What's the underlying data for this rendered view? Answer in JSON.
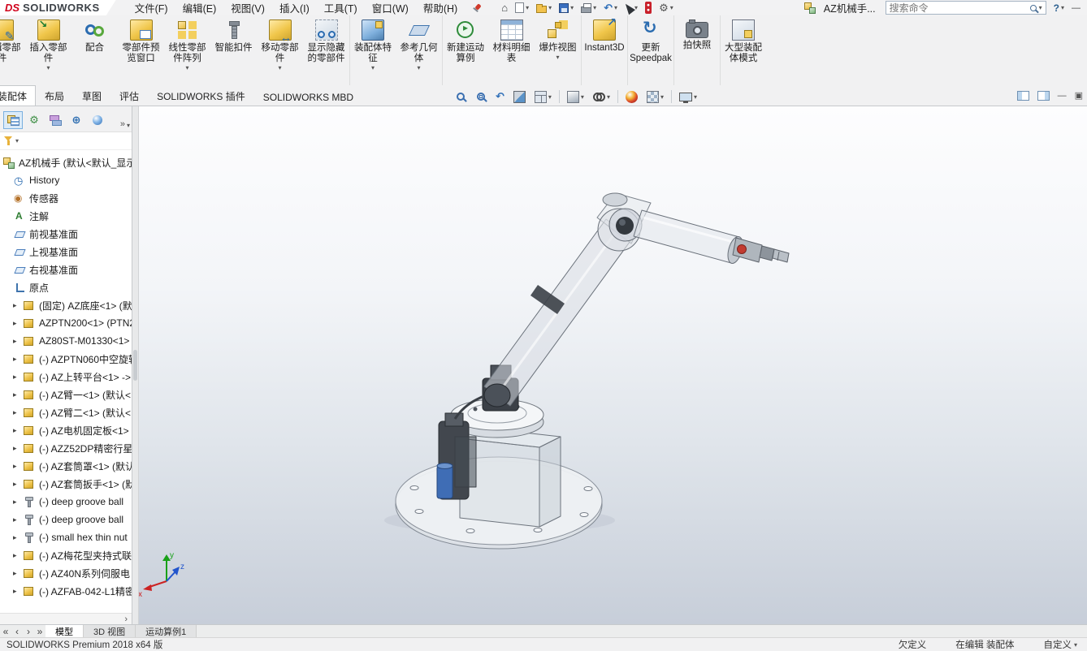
{
  "glyphs": {
    "caret": "▾",
    "expand": "▸",
    "home": "⌂",
    "undo": "↶",
    "gear": "⚙",
    "help": "?",
    "minimize": "—",
    "maximize": "▣",
    "nav_first": "«",
    "nav_prev": "‹",
    "nav_next": "›",
    "nav_last": "»",
    "panel_overflow": "»",
    "tree_scroll": "›",
    "prev_view": "↶",
    "dimxpert": "⊕"
  },
  "app": {
    "logo_prefix": "DS",
    "logo_name": "SOLIDWORKS",
    "document_title": "AZ机械手...",
    "search_placeholder": "搜索命令"
  },
  "menubar": [
    {
      "label": "文件(F)"
    },
    {
      "label": "编辑(E)"
    },
    {
      "label": "视图(V)"
    },
    {
      "label": "插入(I)"
    },
    {
      "label": "工具(T)"
    },
    {
      "label": "窗口(W)"
    },
    {
      "label": "帮助(H)"
    }
  ],
  "qat_icons": [
    "home",
    "new-document",
    "open",
    "save",
    "print",
    "undo",
    "select-cursor",
    "red-indicator",
    "options-gear"
  ],
  "ribbon": [
    {
      "label": "编辑零部件",
      "icon": "edit-component",
      "caret": false,
      "sep": false
    },
    {
      "label": "插入零部件",
      "icon": "insert-component",
      "caret": true,
      "sep": false
    },
    {
      "label": "配合",
      "icon": "mate",
      "caret": false,
      "sep": false
    },
    {
      "label": "零部件预览窗口",
      "icon": "component-preview",
      "caret": false,
      "sep": false
    },
    {
      "label": "线性零部件阵列",
      "icon": "linear-pattern",
      "caret": true,
      "sep": false
    },
    {
      "label": "智能扣件",
      "icon": "smart-fasteners",
      "caret": false,
      "sep": false
    },
    {
      "label": "移动零部件",
      "icon": "move-component",
      "caret": true,
      "sep": false
    },
    {
      "label": "显示隐藏的零部件",
      "icon": "show-hidden",
      "caret": false,
      "sep": false
    },
    {
      "label": "装配体特征",
      "icon": "assembly-features",
      "caret": true,
      "sep": true
    },
    {
      "label": "参考几何体",
      "icon": "reference-geometry",
      "caret": true,
      "sep": false
    },
    {
      "label": "新建运动算例",
      "icon": "motion-study",
      "caret": false,
      "sep": true
    },
    {
      "label": "材料明细表",
      "icon": "bom",
      "caret": false,
      "sep": false
    },
    {
      "label": "爆炸视图",
      "icon": "exploded-view",
      "caret": true,
      "sep": false
    },
    {
      "label": "Instant3D",
      "icon": "instant3d",
      "caret": false,
      "sep": true
    },
    {
      "label": "更新Speedpak",
      "icon": "speedpak",
      "caret": false,
      "sep": true
    },
    {
      "label": "拍快照",
      "icon": "snapshot",
      "caret": false,
      "sep": true
    },
    {
      "label": "大型装配体模式",
      "icon": "large-assembly",
      "caret": false,
      "sep": true
    }
  ],
  "command_tabs": [
    "装配体",
    "布局",
    "草图",
    "评估",
    "SOLIDWORKS 插件",
    "SOLIDWORKS MBD"
  ],
  "headsup_icons": [
    "zoom-fit",
    "zoom-area",
    "previous-view",
    "section-view",
    "view-orientation",
    "display-style",
    "hide-show-items",
    "edit-appearance",
    "apply-scene",
    "view-settings"
  ],
  "panel_tabs": [
    "featuremanager",
    "propertymanager",
    "configurationmanager",
    "dimxpertmanager",
    "displaymanager"
  ],
  "tree": [
    {
      "label": "AZ机械手 (默认<默认_显示",
      "icon": "assembly",
      "expand": false
    },
    {
      "label": "History",
      "icon": "history",
      "expand": false
    },
    {
      "label": "传感器",
      "icon": "sensor",
      "expand": false
    },
    {
      "label": "注解",
      "icon": "annotations",
      "expand": false
    },
    {
      "label": "前视基准面",
      "icon": "plane",
      "expand": false
    },
    {
      "label": "上视基准面",
      "icon": "plane",
      "expand": false
    },
    {
      "label": "右视基准面",
      "icon": "plane",
      "expand": false
    },
    {
      "label": "原点",
      "icon": "origin",
      "expand": false
    },
    {
      "label": "(固定) AZ底座<1> (默",
      "icon": "part",
      "expand": true
    },
    {
      "label": "AZPTN200<1> (PTN2",
      "icon": "part",
      "expand": true
    },
    {
      "label": "AZ80ST-M01330<1>",
      "icon": "part",
      "expand": true
    },
    {
      "label": "(-) AZPTN060中空旋转",
      "icon": "part",
      "expand": true
    },
    {
      "label": "(-) AZ上转平台<1> ->",
      "icon": "part",
      "expand": true
    },
    {
      "label": "(-) AZ臂一<1> (默认<",
      "icon": "part",
      "expand": true
    },
    {
      "label": "(-) AZ臂二<1> (默认<",
      "icon": "part",
      "expand": true
    },
    {
      "label": "(-) AZ电机固定板<1>",
      "icon": "part",
      "expand": true
    },
    {
      "label": "(-) AZZ52DP精密行星",
      "icon": "part",
      "expand": true
    },
    {
      "label": "(-) AZ套筒罩<1> (默认",
      "icon": "part",
      "expand": true
    },
    {
      "label": "(-) AZ套筒扳手<1> (默",
      "icon": "part",
      "expand": true
    },
    {
      "label": "(-) deep groove ball",
      "icon": "bolt",
      "expand": true
    },
    {
      "label": "(-) deep groove ball",
      "icon": "bolt",
      "expand": true
    },
    {
      "label": "(-) small hex thin nut",
      "icon": "bolt",
      "expand": true
    },
    {
      "label": "(-) AZ梅花型夹持式联",
      "icon": "part",
      "expand": true
    },
    {
      "label": "(-) AZ40N系列伺服电",
      "icon": "part",
      "expand": true
    },
    {
      "label": "(-) AZFAB-042-L1精密",
      "icon": "part",
      "expand": true
    }
  ],
  "viewport": {
    "triad": {
      "x": "x",
      "y": "y",
      "z": "z"
    }
  },
  "bottom_tabs": [
    "模型",
    "3D 视图",
    "运动算例1"
  ],
  "statusbar": {
    "left": "SOLIDWORKS Premium 2018 x64 版",
    "underdefined": "欠定义",
    "editing": "在编辑 装配体",
    "customize": "自定义"
  }
}
